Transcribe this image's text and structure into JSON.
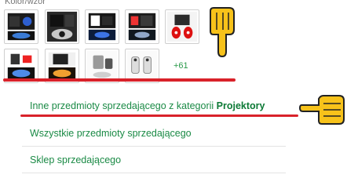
{
  "color_label": "Kolor/wzór",
  "thumbnails": [
    {
      "name": "thumb-1",
      "variant": "projector-logo-blue"
    },
    {
      "name": "thumb-2",
      "variant": "car-door-projector"
    },
    {
      "name": "thumb-3",
      "variant": "projector-box-blue"
    },
    {
      "name": "thumb-4",
      "variant": "projector-box-dark"
    },
    {
      "name": "thumb-5",
      "variant": "projector-red-pair"
    },
    {
      "name": "thumb-6",
      "variant": "projector-box-white"
    },
    {
      "name": "thumb-7",
      "variant": "projector-orange-glow"
    },
    {
      "name": "thumb-8",
      "variant": "projector-silver"
    },
    {
      "name": "thumb-9",
      "variant": "projector-pair-white"
    }
  ],
  "more_count": "+61",
  "links": {
    "other_items_prefix": "Inne przedmioty sprzedającego z kategorii ",
    "other_items_category": "Projektory",
    "all_items": "Wszystkie przedmioty sprzedającego",
    "seller_store": "Sklep sprzedającego"
  },
  "colors": {
    "link_green": "#1a8a45",
    "annotation_red": "#d9222a",
    "hand_yellow": "#f7c21a"
  }
}
